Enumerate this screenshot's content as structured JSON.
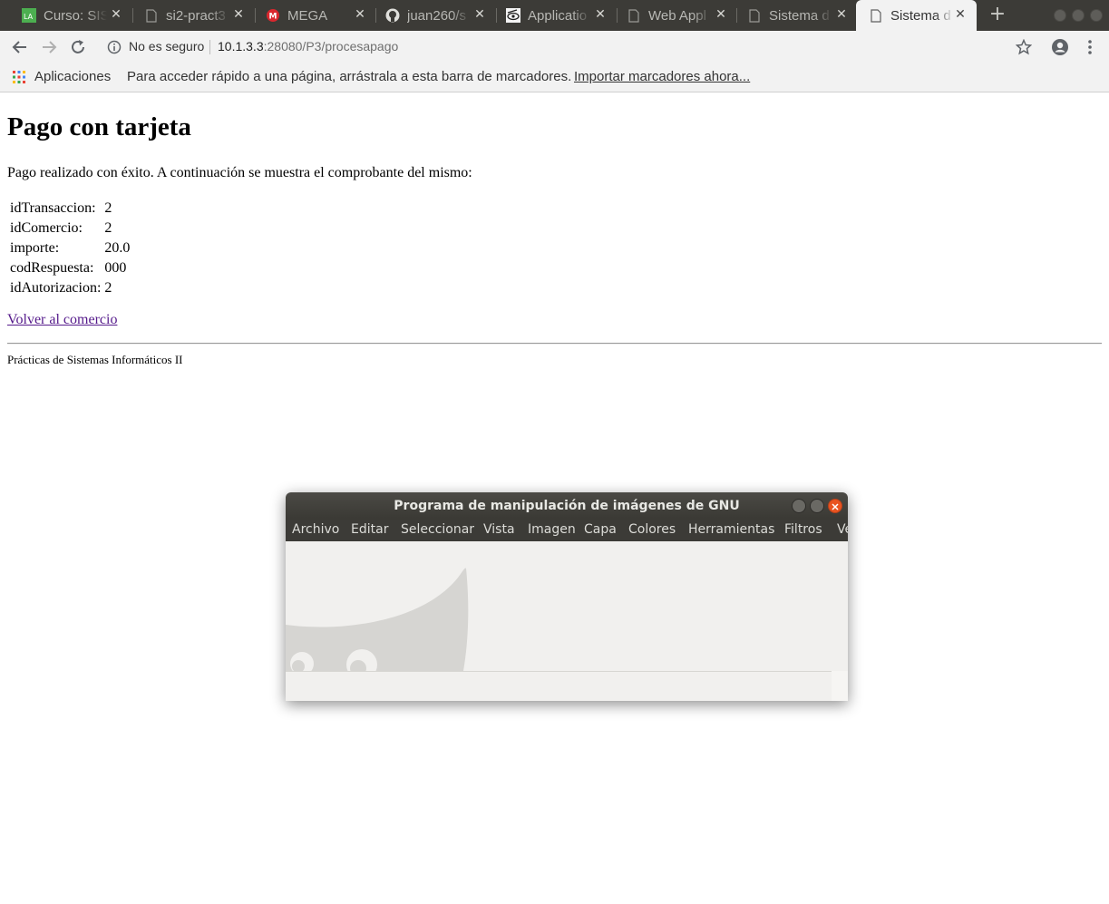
{
  "tabs": [
    {
      "title": "Curso: SIS",
      "icon": "la-favicon-icon"
    },
    {
      "title": "si2-pract3",
      "icon": "page-icon"
    },
    {
      "title": "MEGA",
      "icon": "mega-icon"
    },
    {
      "title": "juan260/s",
      "icon": "github-icon"
    },
    {
      "title": "Applicatio",
      "icon": "eye-icon"
    },
    {
      "title": "Web Appl",
      "icon": "page-icon"
    },
    {
      "title": "Sistema d",
      "icon": "page-icon"
    },
    {
      "title": "Sistema d",
      "icon": "page-icon",
      "active": true
    }
  ],
  "toolbar": {
    "security_text": "No es seguro",
    "url_host": "10.1.3.3",
    "url_rest": ":28080/P3/procesapago"
  },
  "bookmarks": {
    "apps_label": "Aplicaciones",
    "hint": "Para acceder rápido a una página, arrástrala a esta barra de marcadores.",
    "import_link": "Importar marcadores ahora..."
  },
  "page": {
    "title": "Pago con tarjeta",
    "message": "Pago realizado con éxito. A continuación se muestra el comprobante del mismo:",
    "receipt": [
      {
        "label": "idTransaccion:",
        "value": "2"
      },
      {
        "label": "idComercio:",
        "value": "2"
      },
      {
        "label": "importe:",
        "value": "20.0"
      },
      {
        "label": "codRespuesta:",
        "value": "000"
      },
      {
        "label": "idAutorizacion:",
        "value": "2"
      }
    ],
    "back_link": "Volver al comercio",
    "footer": "Prácticas de Sistemas Informáticos II"
  },
  "gimp": {
    "title": "Programa de manipulación de imágenes de GNU",
    "menu": [
      "Archivo",
      "Editar",
      "Seleccionar",
      "Vista",
      "Imagen",
      "Capa",
      "Colores",
      "Herramientas",
      "Filtros",
      "Ve"
    ]
  },
  "colors": {
    "tabstrip": "#3c3b37",
    "toolbar": "#f2f2f2",
    "visited_link": "#551a8b",
    "gimp_close": "#e95420"
  }
}
